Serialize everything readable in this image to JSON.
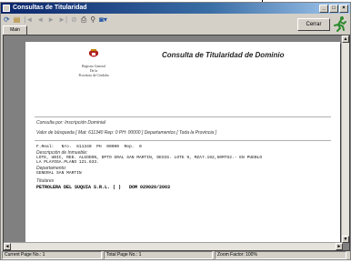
{
  "window": {
    "title": "Consultas de Titularidad"
  },
  "toolbar": {
    "close_label": "Cerrar"
  },
  "tabs": [
    {
      "label": "Main Report"
    }
  ],
  "report": {
    "logo_lines": [
      "Registro General",
      "De la",
      "Provincia de Córdoba"
    ],
    "title": "Consulta de Titularidad de Dominio",
    "consulta_por": "Consulta por: Inscripción Dominial",
    "valor_busqueda": "Valor de búsqueda  [ Mat: 611340 Rep: 0 PH: 00000 ]   Departamentos   [ Toda la Provincia ]",
    "registro_line": "F.Real:   Nro.  611340  PH  00000  Rep.  0",
    "descripcion_label": "Descripción de Inmueble:",
    "descripcion_text": "LOTE, UBIC, RED. ALGODON, DPTO GRAL SAN MARTIN, DESIG. LOTE 9, MZA7.192,50MTS2.- EN PUEBLO\nLA PLAYOSA.PLANO 121.633.",
    "departamento_label": "Departamento:",
    "departamento_value": "GENERAL SAN MARTIN",
    "titulares_label": "Titulares",
    "titular_line": "PETROLERA DEL SUQUIA S.R.L. ( )   DOM 029020/2003"
  },
  "status": {
    "current_page": "Current Page No.: 1",
    "total_pages": "Total Page No.: 1",
    "zoom": "Zoom Factor: 100%"
  }
}
